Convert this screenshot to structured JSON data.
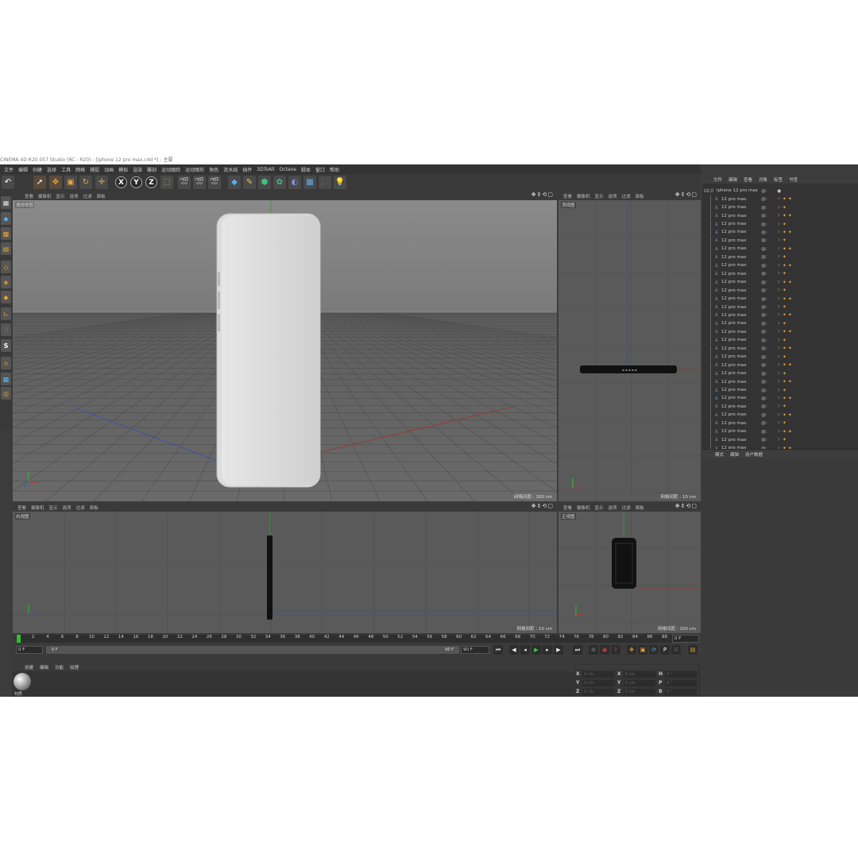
{
  "window_title": "CINEMA 4D R20.057 Studio (RC - R20) - [iphone 12 pro max.c4d *] - 主要",
  "menu": [
    "文件",
    "编辑",
    "创建",
    "选择",
    "工具",
    "网格",
    "捕捉",
    "动画",
    "模拟",
    "渲染",
    "雕刻",
    "运动跟踪",
    "运动图形",
    "角色",
    "流水线",
    "插件",
    "3DToAll",
    "Octane",
    "脚本",
    "窗口",
    "帮助"
  ],
  "toolbar": {
    "undo_icon": "undo-icon",
    "axes": [
      "X",
      "Y",
      "Z"
    ]
  },
  "viewport_menu": [
    "查看",
    "摄像机",
    "显示",
    "选项",
    "过滤",
    "面板"
  ],
  "viewports": {
    "perspective": {
      "label": "透视视图",
      "grid": "网格间距 : 100 cm"
    },
    "top": {
      "label": "顶视图",
      "grid": "网格间距 : 10 cm"
    },
    "right": {
      "label": "右视图",
      "grid": "网格间距 : 10 cm"
    },
    "front": {
      "label": "正视图",
      "grid": "网格间距 : 100 cm"
    }
  },
  "object_manager": {
    "tabs": [
      "文件",
      "编辑",
      "查看",
      "对象",
      "标签",
      "书签"
    ],
    "root": "iphone 12 pro max",
    "children": [
      "12 pro max",
      "12 pro max",
      "12 pro max",
      "12 pro max",
      "12 pro max",
      "12 pro max",
      "12 pro max",
      "12 pro max",
      "12 pro max",
      "12 pro max",
      "12 pro max",
      "12 pro max",
      "12 pro max",
      "12 pro max",
      "12 pro max",
      "12 pro max",
      "12 pro max",
      "12 pro max",
      "12 pro max",
      "12 pro max",
      "12 pro max",
      "12 pro max",
      "12 pro max",
      "12 pro max",
      "12 pro max",
      "12 pro max",
      "12 pro max",
      "12 pro max",
      "12 pro max",
      "12 pro max",
      "12 pro max"
    ]
  },
  "attribute_manager": {
    "tabs": [
      "模式",
      "编辑",
      "用户数据"
    ]
  },
  "timeline": {
    "ticks": [
      "0",
      "2",
      "4",
      "6",
      "8",
      "10",
      "12",
      "14",
      "16",
      "18",
      "20",
      "22",
      "24",
      "26",
      "28",
      "30",
      "32",
      "34",
      "36",
      "38",
      "40",
      "42",
      "44",
      "46",
      "48",
      "50",
      "52",
      "54",
      "56",
      "58",
      "60",
      "62",
      "64",
      "66",
      "68",
      "70",
      "72",
      "74",
      "76",
      "78",
      "80",
      "82",
      "84",
      "86",
      "88",
      "90"
    ],
    "current_frame": "0 F",
    "start_field": "0 F",
    "range_start": "0 F",
    "range_end": "90 F",
    "end_field": "90 F",
    "playhead": 0
  },
  "material_manager": {
    "tabs": [
      "创建",
      "编辑",
      "功能",
      "纹理"
    ],
    "material_name": "材质"
  },
  "coordinates": {
    "rows": [
      {
        "a": "X",
        "av": "0 cm",
        "b": "X",
        "bv": "0 cm",
        "c": "H",
        "cv": "0 °"
      },
      {
        "a": "Y",
        "av": "0 cm",
        "b": "Y",
        "bv": "0 cm",
        "c": "P",
        "cv": "0 °"
      },
      {
        "a": "Z",
        "av": "0 cm",
        "b": "Z",
        "bv": "0 cm",
        "c": "B",
        "cv": "0 °"
      }
    ]
  }
}
